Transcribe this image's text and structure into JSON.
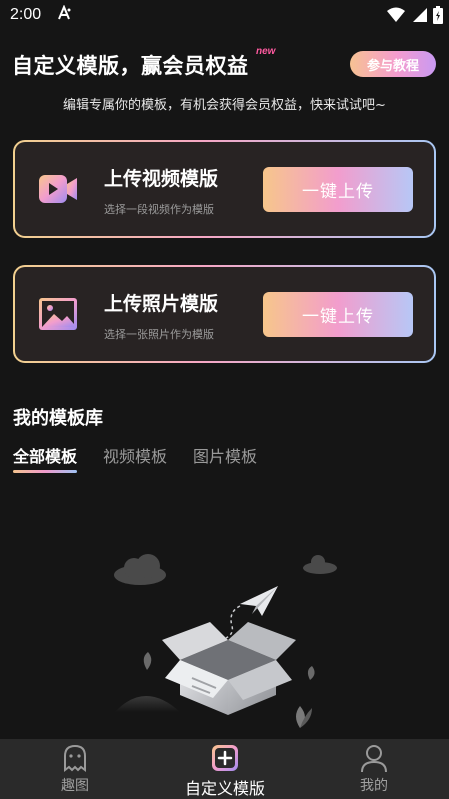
{
  "status_bar": {
    "time": "2:00"
  },
  "header": {
    "title": "自定义模版，赢会员权益",
    "new_tag": "new",
    "tutorial_button": "参与教程",
    "subtitle": "编辑专属你的模板，有机会获得会员权益，快来试试吧~"
  },
  "cards": [
    {
      "title": "上传视频模版",
      "desc": "选择一段视频作为模版",
      "button": "一键上传",
      "icon": "video-icon"
    },
    {
      "title": "上传照片模版",
      "desc": "选择一张照片作为模版",
      "button": "一键上传",
      "icon": "image-icon"
    }
  ],
  "library": {
    "title": "我的模板库",
    "tabs": [
      {
        "label": "全部模板",
        "active": true
      },
      {
        "label": "视频模板",
        "active": false
      },
      {
        "label": "图片模板",
        "active": false
      }
    ]
  },
  "bottom_nav": [
    {
      "label": "趣图",
      "icon": "ghost-icon",
      "active": false
    },
    {
      "label": "自定义模版",
      "icon": "add-icon",
      "active": true
    },
    {
      "label": "我的",
      "icon": "profile-icon",
      "active": false
    }
  ],
  "colors": {
    "background": "#151515",
    "card_background": "#282323",
    "accent_gradient": [
      "#f7c68b",
      "#f29dcd",
      "#b7c7f6"
    ],
    "nav_background": "#2a2a2a"
  }
}
